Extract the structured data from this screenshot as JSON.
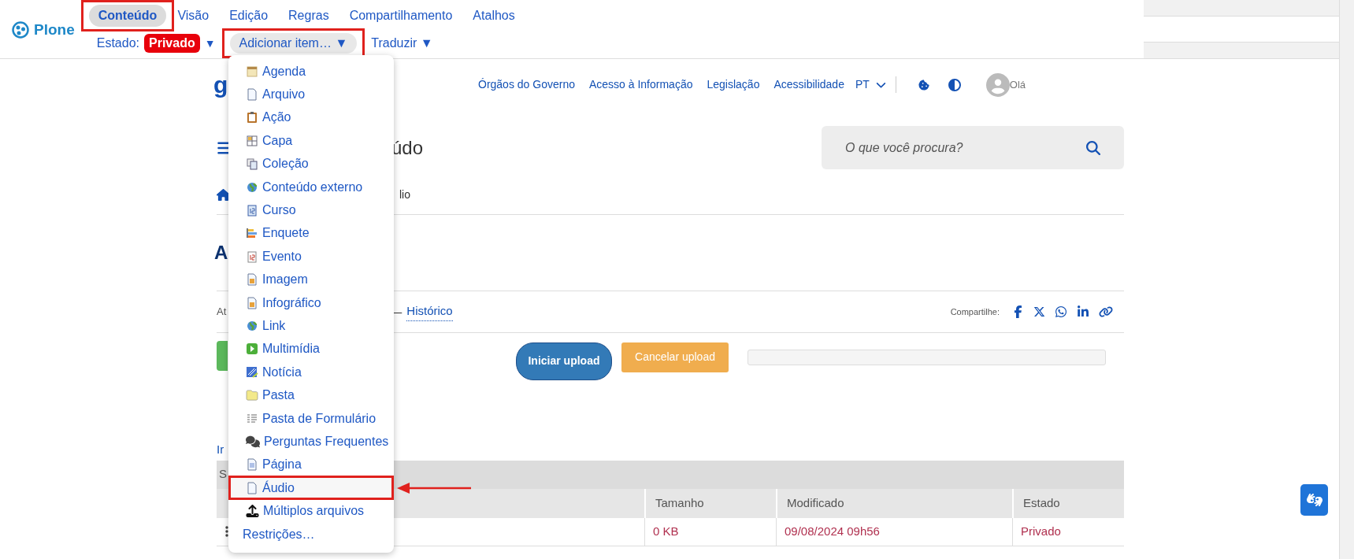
{
  "toolbar": {
    "logo": "Plone",
    "tabs": [
      {
        "label": "Conteúdo",
        "selected": true,
        "highlighted": true
      },
      {
        "label": "Visão",
        "selected": false,
        "highlighted": false
      },
      {
        "label": "Edição",
        "selected": false,
        "highlighted": false
      },
      {
        "label": "Regras",
        "selected": false,
        "highlighted": false
      },
      {
        "label": "Compartilhamento",
        "selected": false,
        "highlighted": false
      },
      {
        "label": "Atalhos",
        "selected": false,
        "highlighted": false
      }
    ],
    "state_label": "Estado:",
    "state_value": "Privado",
    "state_caret": "▼",
    "add_item": {
      "label": "Adicionar item…",
      "caret": "▼",
      "highlighted": true
    },
    "translate": {
      "label": "Traduzir",
      "caret": "▼"
    }
  },
  "add_menu": {
    "items": [
      {
        "label": "Agenda",
        "highlighted": false
      },
      {
        "label": "Arquivo",
        "highlighted": false
      },
      {
        "label": "Ação",
        "highlighted": false
      },
      {
        "label": "Capa",
        "highlighted": false
      },
      {
        "label": "Coleção",
        "highlighted": false
      },
      {
        "label": "Conteúdo externo",
        "highlighted": false
      },
      {
        "label": "Curso",
        "highlighted": false
      },
      {
        "label": "Enquete",
        "highlighted": false
      },
      {
        "label": "Evento",
        "highlighted": false
      },
      {
        "label": "Imagem",
        "highlighted": false
      },
      {
        "label": "Infográfico",
        "highlighted": false
      },
      {
        "label": "Link",
        "highlighted": false
      },
      {
        "label": "Multimídia",
        "highlighted": false
      },
      {
        "label": "Notícia",
        "highlighted": false
      },
      {
        "label": "Pasta",
        "highlighted": false
      },
      {
        "label": "Pasta de Formulário",
        "highlighted": false
      },
      {
        "label": "Perguntas Frequentes",
        "highlighted": false
      },
      {
        "label": "Página",
        "highlighted": false
      },
      {
        "label": "Áudio",
        "highlighted": true
      },
      {
        "label": "Múltiplos arquivos",
        "highlighted": false
      }
    ],
    "footer": "Restrições…"
  },
  "site": {
    "logo_fragment": "g",
    "nav_links": [
      "Órgãos do Governo",
      "Acesso à Informação",
      "Legislação",
      "Acessibilidade"
    ],
    "language": "PT",
    "greeting": "Olá",
    "title_fragment": "údo",
    "search": {
      "placeholder": "O que você procura?"
    },
    "breadcrumb_fragment": "lio",
    "heading_fragment": "A",
    "byline_fragment": "At",
    "separator": "—",
    "history_link": "Histórico",
    "share_label": "Compartilhe:",
    "upload_buttons": {
      "start": "Iniciar upload",
      "cancel": "Cancelar upload"
    },
    "progress": {
      "level": 0
    },
    "link_fragment": "Ir",
    "table": {
      "caption_fragment": "S",
      "columns": [
        "Tamanho",
        "Modificado",
        "Estado"
      ],
      "rows": [
        {
          "cells": [
            "0 KB",
            "09/08/2024 09h56",
            "Privado"
          ]
        }
      ]
    }
  }
}
